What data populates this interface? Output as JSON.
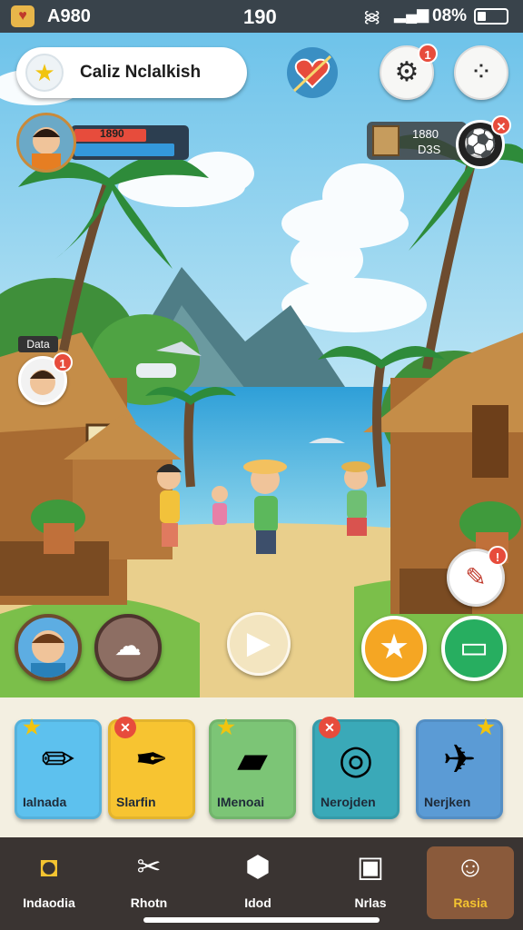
{
  "status_bar": {
    "app_name": "A980",
    "time": "190",
    "battery_percent": "08%",
    "battery_level": 0.3
  },
  "hud": {
    "quest_title": "Caliz Nclalkish",
    "settings_badge": "1",
    "player": {
      "level_text": "1890",
      "health": 0.65,
      "xp": 0.9,
      "health_color": "#e74c3c",
      "xp_color": "#3498db"
    },
    "resources": {
      "line1": "1880",
      "line2": "D3S"
    },
    "npc_tag": "Data",
    "npc_badge": "1"
  },
  "cards": [
    {
      "label": "Ialnada",
      "icon": "eraser-icon",
      "badge": "star",
      "color": "#5dc1ee"
    },
    {
      "label": "Slarfin",
      "icon": "marker-icon",
      "badge": "x",
      "color": "#f7c431"
    },
    {
      "label": "IMenoai",
      "icon": "cube-icon",
      "badge": "star",
      "color": "#7cc576"
    },
    {
      "label": "Nerojden",
      "icon": "rings-icon",
      "badge": "x",
      "color": "#3aa9b8"
    },
    {
      "label": "Nerjken",
      "icon": "paper-plane-icon",
      "badge": "star",
      "color": "#5b9bd5"
    }
  ],
  "nav": [
    {
      "label": "Indaodia",
      "icon": "camera-icon",
      "glyph": "◘"
    },
    {
      "label": "Rhotn",
      "icon": "tools-icon",
      "glyph": "✂"
    },
    {
      "label": "Idod",
      "icon": "location-pin-icon",
      "glyph": "⬢"
    },
    {
      "label": "Nrlas",
      "icon": "picture-icon",
      "glyph": "▣"
    },
    {
      "label": "Rasia",
      "icon": "avatar-icon",
      "glyph": "☺",
      "active": true
    }
  ]
}
